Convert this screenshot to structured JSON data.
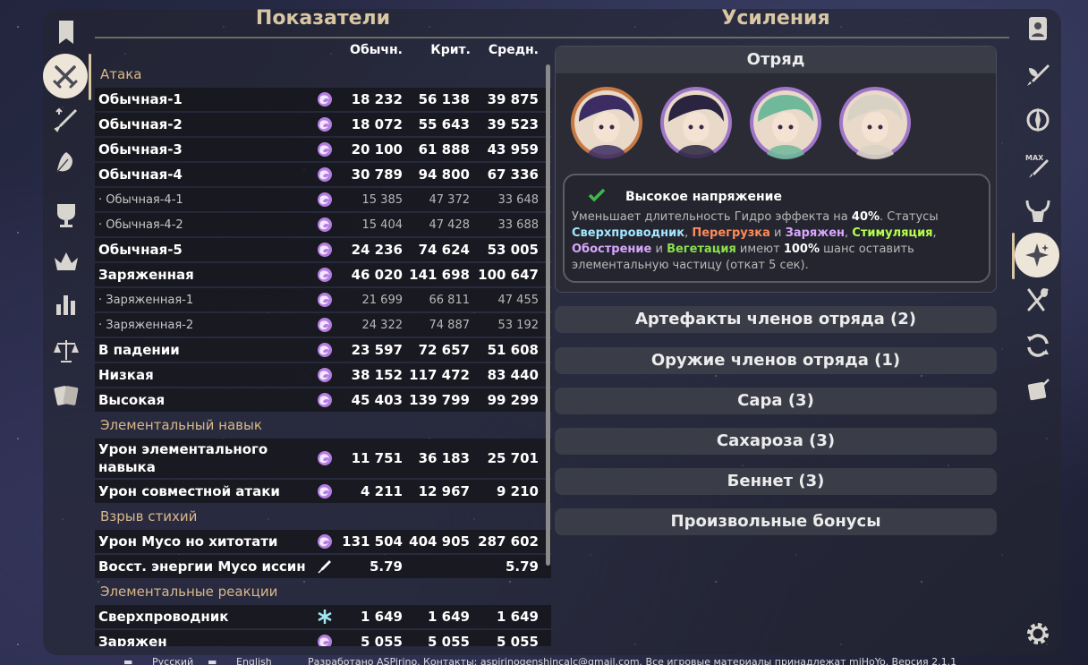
{
  "left_title": "Показатели",
  "right_title": "Усиления",
  "columns": {
    "normal": "Обычн.",
    "crit": "Крит.",
    "avg": "Средн."
  },
  "left_nav": [
    {
      "name": "bookmark-icon"
    },
    {
      "name": "swords-icon",
      "active": true
    },
    {
      "name": "sword-upgrade-icon"
    },
    {
      "name": "leaf-icon"
    },
    {
      "name": "goblet-icon"
    },
    {
      "name": "crown-icon"
    },
    {
      "name": "bar-chart-icon"
    },
    {
      "name": "scales-icon"
    },
    {
      "name": "cards-icon"
    }
  ],
  "right_nav": [
    {
      "name": "character-card-icon"
    },
    {
      "name": "sword-feather-icon"
    },
    {
      "name": "compass-icon"
    },
    {
      "name": "max-level-icon"
    },
    {
      "name": "horned-helmet-icon"
    },
    {
      "name": "sparkle-icon",
      "active": true
    },
    {
      "name": "fork-spoon-icon"
    },
    {
      "name": "refresh-icon"
    },
    {
      "name": "scroll-icon"
    },
    {
      "name": "settings-icon"
    }
  ],
  "rows": [
    {
      "kind": "section",
      "label": "Атака"
    },
    {
      "kind": "main",
      "label": "Обычная-1",
      "icon": "electro",
      "normal": "18 232",
      "crit": "56 138",
      "avg": "39 875"
    },
    {
      "kind": "main",
      "label": "Обычная-2",
      "icon": "electro",
      "normal": "18 072",
      "crit": "55 643",
      "avg": "39 523"
    },
    {
      "kind": "main",
      "label": "Обычная-3",
      "icon": "electro",
      "normal": "20 100",
      "crit": "61 888",
      "avg": "43 959"
    },
    {
      "kind": "main",
      "label": "Обычная-4",
      "icon": "electro",
      "normal": "30 789",
      "crit": "94 800",
      "avg": "67 336"
    },
    {
      "kind": "sub",
      "label": "· Обычная-4-1",
      "icon": "electro",
      "normal": "15 385",
      "crit": "47 372",
      "avg": "33 648"
    },
    {
      "kind": "sub",
      "label": "· Обычная-4-2",
      "icon": "electro",
      "normal": "15 404",
      "crit": "47 428",
      "avg": "33 688"
    },
    {
      "kind": "main",
      "label": "Обычная-5",
      "icon": "electro",
      "normal": "24 236",
      "crit": "74 624",
      "avg": "53 005"
    },
    {
      "kind": "main",
      "label": "Заряженная",
      "icon": "electro",
      "normal": "46 020",
      "crit": "141 698",
      "avg": "100 647"
    },
    {
      "kind": "sub",
      "label": "· Заряженная-1",
      "icon": "electro",
      "normal": "21 699",
      "crit": "66 811",
      "avg": "47 455"
    },
    {
      "kind": "sub",
      "label": "· Заряженная-2",
      "icon": "electro",
      "normal": "24 322",
      "crit": "74 887",
      "avg": "53 192"
    },
    {
      "kind": "main",
      "label": "В падении",
      "icon": "electro",
      "normal": "23 597",
      "crit": "72 657",
      "avg": "51 608"
    },
    {
      "kind": "main",
      "label": "Низкая",
      "icon": "electro",
      "normal": "38 152",
      "crit": "117 472",
      "avg": "83 440"
    },
    {
      "kind": "main",
      "label": "Высокая",
      "icon": "electro",
      "normal": "45 403",
      "crit": "139 799",
      "avg": "99 299"
    },
    {
      "kind": "section",
      "label": "Элементальный навык"
    },
    {
      "kind": "main2",
      "label": "Урон элементального навыка",
      "icon": "electro",
      "normal": "11 751",
      "crit": "36 183",
      "avg": "25 701"
    },
    {
      "kind": "main",
      "label": "Урон совместной атаки",
      "icon": "electro",
      "normal": "4 211",
      "crit": "12 967",
      "avg": "9 210"
    },
    {
      "kind": "section",
      "label": "Взрыв стихий"
    },
    {
      "kind": "main",
      "label": "Урон Мусо но хитотати",
      "icon": "electro",
      "normal": "131 504",
      "crit": "404 905",
      "avg": "287 602"
    },
    {
      "kind": "main",
      "label": "Восст. энергии Мусо иссин",
      "icon": "syringe",
      "normal": "5.79",
      "crit": "",
      "avg": "5.79"
    },
    {
      "kind": "section",
      "label": "Элементальные реакции"
    },
    {
      "kind": "main",
      "label": "Сверхпроводник",
      "icon": "cryo",
      "normal": "1 649",
      "crit": "1 649",
      "avg": "1 649"
    },
    {
      "kind": "main",
      "label": "Заряжен",
      "icon": "electro",
      "normal": "5 055",
      "crit": "5 055",
      "avg": "5 055"
    }
  ],
  "squad": {
    "title": "Отряд",
    "avatars": [
      {
        "name": "raiden-avatar",
        "ring": "#c87a45",
        "hair": "#3b2d63"
      },
      {
        "name": "sara-avatar",
        "ring": "#a076c8",
        "hair": "#2a2440"
      },
      {
        "name": "sucrose-avatar",
        "ring": "#a076c8",
        "hair": "#6fb89a"
      },
      {
        "name": "bennett-avatar",
        "ring": "#a076c8",
        "hair": "#d8d2c4"
      }
    ],
    "bonus_title": "Высокое напряжение",
    "bonus_desc": {
      "p1": "Уменьшает длительность Гидро эффекта на ",
      "pct": "40%",
      "p2": ". Статусы ",
      "r1": "Сверхпроводник",
      "sep1": ", ",
      "r2": "Перегрузка",
      "sep2": " и ",
      "r3": "Заряжен",
      "sep3": ", ",
      "r4": "Стимуляция",
      "sep4": ", ",
      "r5": "Обострение",
      "sep5": " и ",
      "r6": "Вегетация",
      "p3": " имеют ",
      "pct2": "100%",
      "p4": " шанс оставить элементальную частицу (откат 5 сек)."
    },
    "colors": {
      "superconduct": "#a3e6ff",
      "overload": "#ff8a5a",
      "electrocharged": "#d9a6ff",
      "quicken": "#b5ff4a",
      "aggravate": "#d9a6ff",
      "spread": "#8ae04a"
    }
  },
  "sections": [
    "Артефакты членов отряда (2)",
    "Оружие членов отряда (1)",
    "Сара (3)",
    "Сахароза (3)",
    "Беннет (3)",
    "Произвольные бонусы"
  ],
  "footer": {
    "lang_ru": "Русский",
    "lang_en": "English",
    "credits": "Разработано ASPirino. Контакты: aspirinogenshincalc@gmail.com. Все игровые материалы принадлежат miHoYo. Версия 2.1.1"
  }
}
